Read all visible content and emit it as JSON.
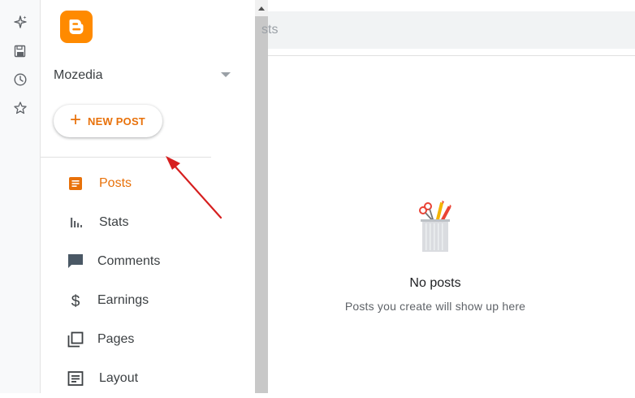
{
  "rail": {
    "icons": [
      "sparkle-icon",
      "save-icon",
      "history-icon",
      "star-icon"
    ]
  },
  "sidebar": {
    "blog_name": "Mozedia",
    "new_post_label": "NEW POST",
    "items": [
      {
        "label": "Posts",
        "icon": "posts-icon",
        "active": true
      },
      {
        "label": "Stats",
        "icon": "stats-icon",
        "active": false
      },
      {
        "label": "Comments",
        "icon": "comments-icon",
        "active": false
      },
      {
        "label": "Earnings",
        "icon": "dollar-icon",
        "active": false
      },
      {
        "label": "Pages",
        "icon": "pages-icon",
        "active": false
      },
      {
        "label": "Layout",
        "icon": "layout-icon",
        "active": false
      }
    ]
  },
  "search": {
    "text": "sts"
  },
  "empty_state": {
    "title": "No posts",
    "subtitle": "Posts you create will show up here"
  },
  "colors": {
    "accent": "#e8710a",
    "logo": "#ff8a00",
    "annotation_arrow": "#d61f1f"
  }
}
